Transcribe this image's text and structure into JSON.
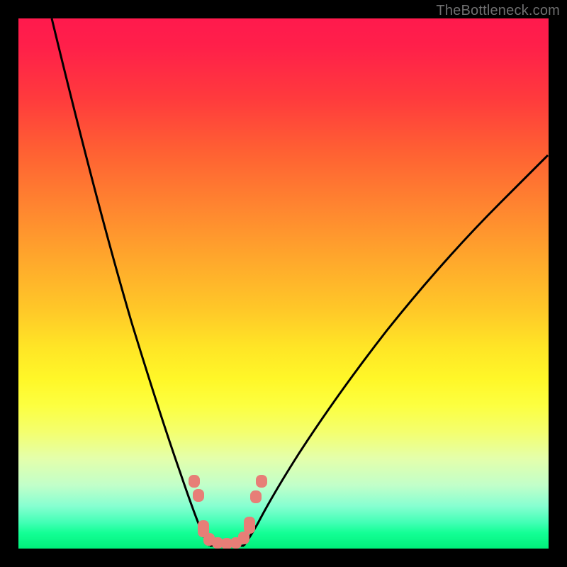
{
  "watermark": "TheBottleneck.com",
  "colors": {
    "gradient_top": "#ff1a4d",
    "gradient_mid": "#ffe526",
    "gradient_bottom": "#00f07a",
    "curve": "#000000",
    "marker": "#e77e77",
    "background": "#000000",
    "watermark_text": "#6f6f70"
  },
  "chart_data": {
    "type": "line",
    "title": "",
    "xlabel": "",
    "ylabel": "",
    "xlim": [
      0,
      100
    ],
    "ylim": [
      0,
      100
    ],
    "legend": false,
    "grid": false,
    "description": "Bottleneck-style V curve plotted over a vertical red→yellow→green gradient. Two black curves descend from the upper-left and upper-right toward a minimum at the bottom; a cluster of pink rounded markers sits around the trough. No axes, ticks, or textual labels are visible; values below are estimated from pixel positions.",
    "series": [
      {
        "name": "left-curve",
        "x": [
          6,
          15,
          21,
          28,
          32,
          35,
          36.5
        ],
        "values": [
          100,
          65,
          43,
          15,
          6,
          2,
          0
        ]
      },
      {
        "name": "right-curve",
        "x": [
          42.5,
          45,
          50,
          58,
          70,
          82,
          92,
          100
        ],
        "values": [
          0,
          2,
          8,
          18,
          36,
          52,
          65,
          74
        ]
      }
    ],
    "markers": {
      "name": "highlight-points",
      "color": "#e77e77",
      "points": [
        {
          "x": 33,
          "y": 13
        },
        {
          "x": 34,
          "y": 10.5
        },
        {
          "x": 35,
          "y": 4
        },
        {
          "x": 36,
          "y": 1.5
        },
        {
          "x": 38,
          "y": 0.8
        },
        {
          "x": 39.5,
          "y": 0.7
        },
        {
          "x": 41,
          "y": 0.8
        },
        {
          "x": 42.5,
          "y": 1.6
        },
        {
          "x": 43.5,
          "y": 4.3
        },
        {
          "x": 44.7,
          "y": 10
        },
        {
          "x": 45.8,
          "y": 13
        }
      ]
    }
  }
}
